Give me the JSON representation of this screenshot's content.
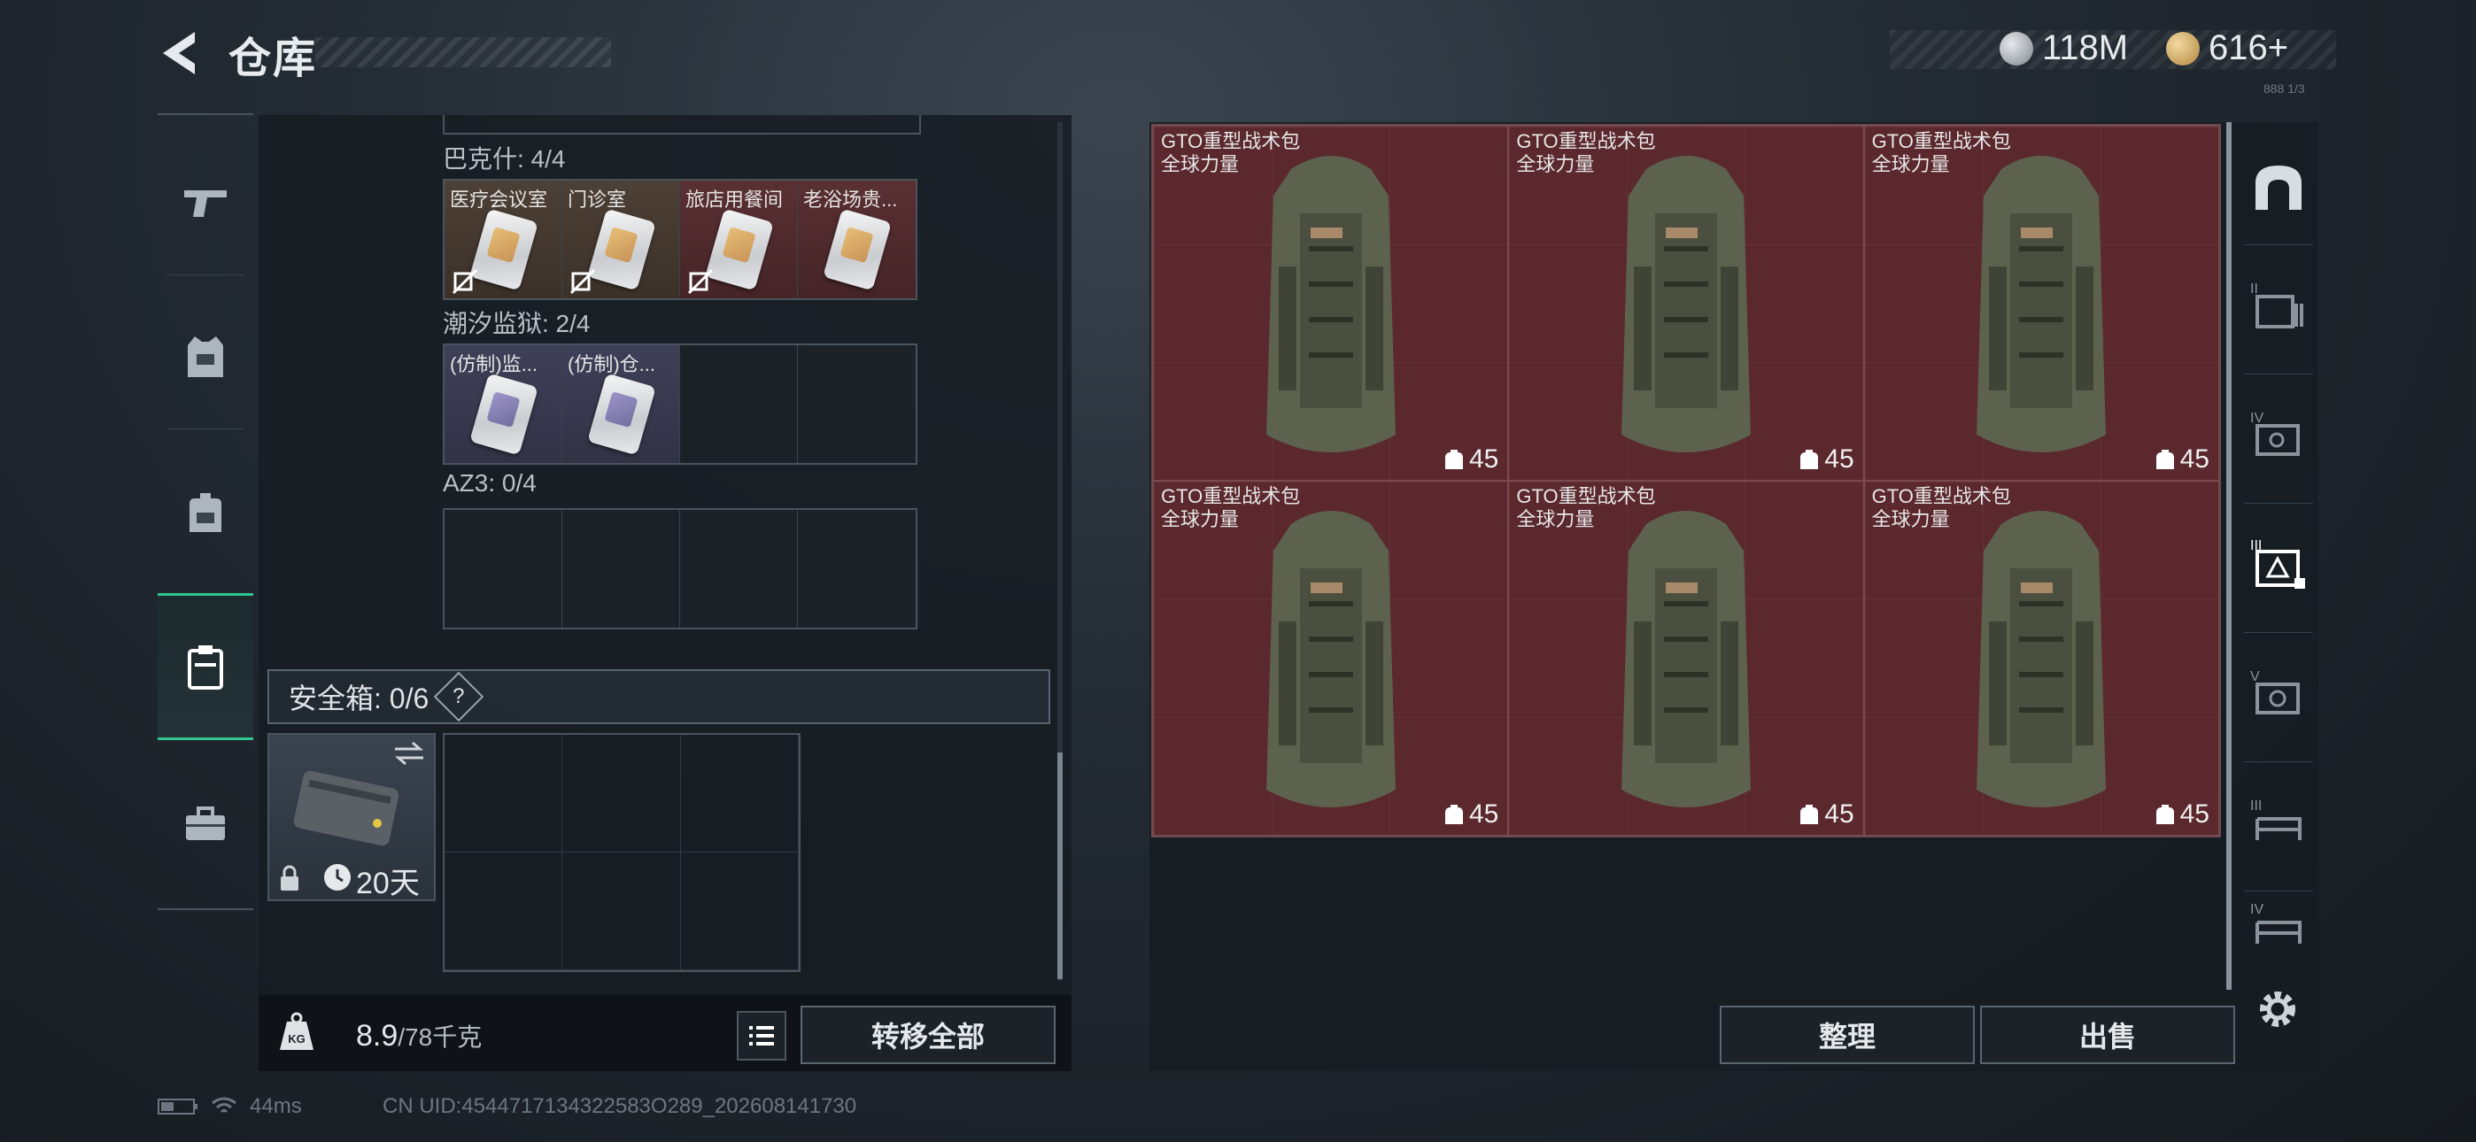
{
  "header": {
    "title": "仓库",
    "currency_silver": "118M",
    "currency_gold": "616+",
    "currency_tag": "888 1/3"
  },
  "left_nav": {
    "items": [
      {
        "name": "weapons",
        "icon": "pistol-icon"
      },
      {
        "name": "helmet-armor",
        "icon": "vest-icon"
      },
      {
        "name": "backpack",
        "icon": "backpack-icon"
      },
      {
        "name": "keys",
        "icon": "keycard-holder-icon",
        "active": true
      },
      {
        "name": "toolbox",
        "icon": "briefcase-icon"
      }
    ]
  },
  "key_sections": [
    {
      "label": "巴克什: 4/4",
      "slots": [
        {
          "name": "医疗会议室",
          "style": "brown",
          "restricted": true
        },
        {
          "name": "门诊室",
          "style": "brown",
          "restricted": true
        },
        {
          "name": "旅店用餐间",
          "style": "red",
          "restricted": true
        },
        {
          "name": "老浴场贵...",
          "style": "red",
          "restricted": false
        }
      ]
    },
    {
      "label": "潮汐监狱: 2/4",
      "slots": [
        {
          "name": "(仿制)监...",
          "style": "purple",
          "restricted": false
        },
        {
          "name": "(仿制)仓...",
          "style": "purple",
          "restricted": false
        },
        {
          "name": "",
          "style": "empty"
        },
        {
          "name": "",
          "style": "empty"
        }
      ]
    },
    {
      "label": "AZ3: 0/4",
      "slots": [
        {
          "name": "",
          "style": "empty"
        },
        {
          "name": "",
          "style": "empty"
        },
        {
          "name": "",
          "style": "empty"
        },
        {
          "name": "",
          "style": "empty"
        }
      ]
    }
  ],
  "safe_box": {
    "label": "安全箱: 0/6",
    "help": "?",
    "duration": "20天"
  },
  "bottom_left": {
    "weight_icon_label": "KG",
    "weight_current": "8.9",
    "weight_max": "/78千克",
    "transfer_all": "转移全部"
  },
  "stash_items": [
    {
      "name": "GTO重型战术包",
      "sub": "全球力量",
      "durability": "45"
    },
    {
      "name": "GTO重型战术包",
      "sub": "全球力量",
      "durability": "45"
    },
    {
      "name": "GTO重型战术包",
      "sub": "全球力量",
      "durability": "45"
    },
    {
      "name": "GTO重型战术包",
      "sub": "全球力量",
      "durability": "45"
    },
    {
      "name": "GTO重型战术包",
      "sub": "全球力量",
      "durability": "45"
    },
    {
      "name": "GTO重型战术包",
      "sub": "全球力量",
      "durability": "45"
    }
  ],
  "right_actions": {
    "sort": "整理",
    "sell": "出售"
  },
  "right_nav": {
    "items": [
      {
        "icon": "arch-icon",
        "tier": ""
      },
      {
        "icon": "storage-icon",
        "tier": "II"
      },
      {
        "icon": "safe-icon",
        "tier": "IV"
      },
      {
        "icon": "warehouse-icon",
        "tier": "III",
        "active": true
      },
      {
        "icon": "vault-icon",
        "tier": "V"
      },
      {
        "icon": "rack-icon",
        "tier": "III"
      },
      {
        "icon": "rack-icon",
        "tier": "IV"
      }
    ]
  },
  "status": {
    "ping": "44ms",
    "uid": "CN UID:4544717134322583O289_202608141730"
  },
  "colors": {
    "accent_green": "#2fc78e",
    "item_red": "#5b282e",
    "panel_bg": "#161c22"
  }
}
